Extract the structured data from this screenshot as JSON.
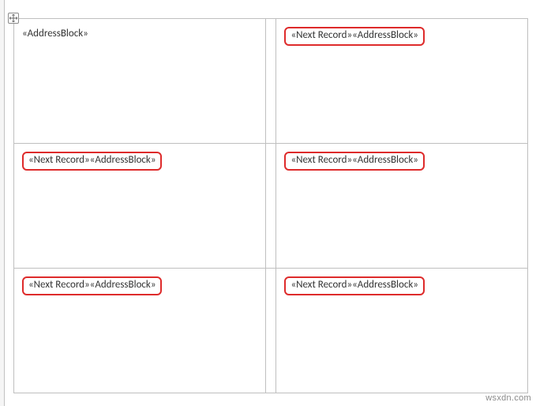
{
  "fields": {
    "address_block": "«AddressBlock»",
    "next_record_address_block": "«Next Record»«AddressBlock»"
  },
  "cells": {
    "r1c1": {
      "text_key": "address_block",
      "highlighted": false
    },
    "r1c2": {
      "text_key": "next_record_address_block",
      "highlighted": true
    },
    "r2c1": {
      "text_key": "next_record_address_block",
      "highlighted": true
    },
    "r2c2": {
      "text_key": "next_record_address_block",
      "highlighted": true
    },
    "r3c1": {
      "text_key": "next_record_address_block",
      "highlighted": true
    },
    "r3c2": {
      "text_key": "next_record_address_block",
      "highlighted": true
    }
  },
  "watermark": "wsxdn.com",
  "highlight_color": "#de2b2b"
}
